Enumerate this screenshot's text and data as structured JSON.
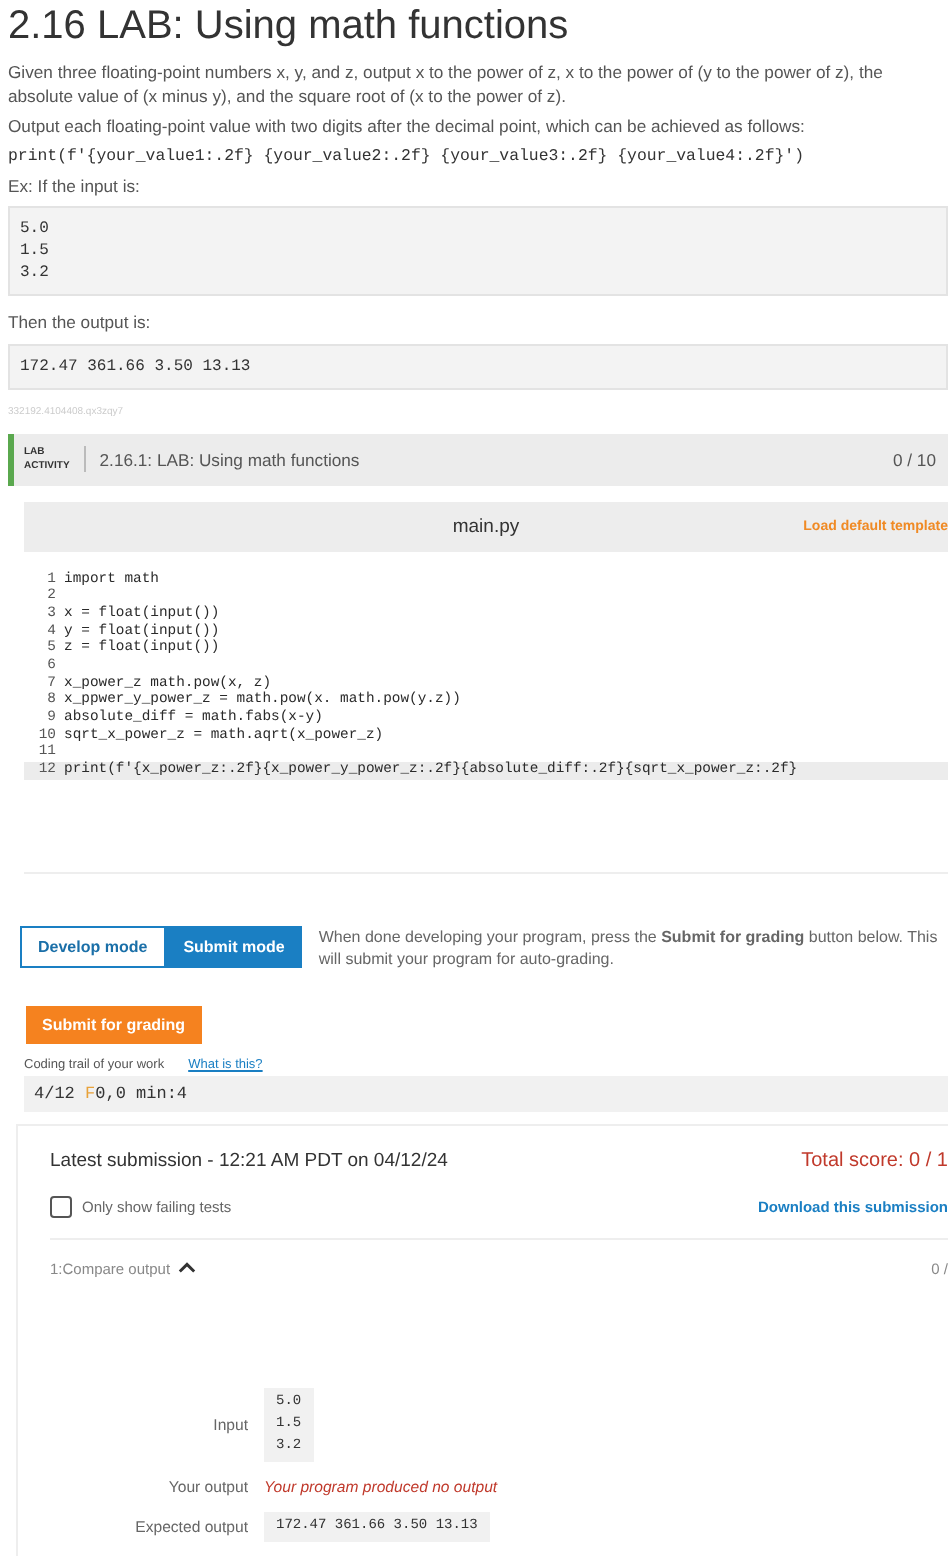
{
  "title": "2.16 LAB: Using math functions",
  "intro": [
    "Given three floating-point numbers x, y, and z, output x to the power of z, x to the power of (y to the power of z), the absolute value of (x minus y), and the square root of (x to the power of z).",
    "Output each floating-point value with two digits after the decimal point, which can be achieved as follows:"
  ],
  "format_code": "print(f'{your_value1:.2f} {your_value2:.2f} {your_value3:.2f} {your_value4:.2f}')",
  "example_label": "Ex: If the input is:",
  "example_input": [
    "5.0",
    "1.5",
    "3.2"
  ],
  "output_label": "Then the output is:",
  "example_output": "172.47 361.66 3.50 13.13",
  "content_id": "332192.4104408.qx3zqy7",
  "lab": {
    "badge": [
      "LAB",
      "ACTIVITY"
    ],
    "title": "2.16.1: LAB: Using math functions",
    "score": "0 / 10"
  },
  "editor": {
    "filename": "main.py",
    "template_link": "Load default template",
    "lines": [
      {
        "number": "1",
        "text": "import math",
        "active": false
      },
      {
        "number": "2",
        "active": false
      },
      {
        "number": "3",
        "text": "x = float(input())",
        "active": false
      },
      {
        "number": "4",
        "text": "y = float(input())",
        "active": false
      },
      {
        "number": "5",
        "text": "z = float(input())",
        "active": false
      },
      {
        "number": "6",
        "active": false
      },
      {
        "number": "7",
        "text": "x_power_z math.pow(x, z)",
        "active": false
      },
      {
        "number": "8",
        "text": "x_ppwer_y_power_z = math.pow(x. math.pow(y.z))",
        "active": false
      },
      {
        "number": "9",
        "text": "absolute_diff = math.fabs(x-y)",
        "active": false
      },
      {
        "number": "10",
        "text": "sqrt_x_power_z = math.aqrt(x_power_z)",
        "active": false
      },
      {
        "number": "11",
        "active": false
      },
      {
        "number": "12",
        "text": "print(f'{x_power_z:.2f}{x_power_y_power_z:.2f}{absolute_diff:.2f}{sqrt_x_power_z:.2f}",
        "active": true
      }
    ]
  },
  "modes": [
    {
      "label": "Develop mode",
      "selected": false
    },
    {
      "label": "Submit mode",
      "selected": true
    }
  ],
  "mode_note": "When done developing your program, press the **Submit for grading** button below. This will submit your program for auto-grading.",
  "submit_button": "Submit for grading",
  "trail": {
    "label": "Coding trail of your work",
    "link": "What is this?",
    "parts": [
      {
        "text": "4/12 ",
        "kind": "plain"
      },
      {
        "text": "F",
        "kind": "flag"
      },
      {
        "text": "0,0 min:4",
        "kind": "plain"
      }
    ]
  },
  "submission": {
    "title": "Latest submission - 12:21 AM PDT on 04/12/24",
    "total": "Total score: 0 / 1",
    "filter": {
      "label": "Only show failing tests",
      "checked": false
    },
    "download": "Download this submission",
    "test": {
      "name": "1:Compare output",
      "expanded": true,
      "score": "0 /",
      "input_label": "Input",
      "input": [
        "5.0",
        "1.5",
        "3.2"
      ],
      "your_label": "Your output",
      "your_output": "Your program produced no output",
      "expected_label": "Expected output",
      "expected": "172.47 361.66 3.50 13.13"
    }
  }
}
